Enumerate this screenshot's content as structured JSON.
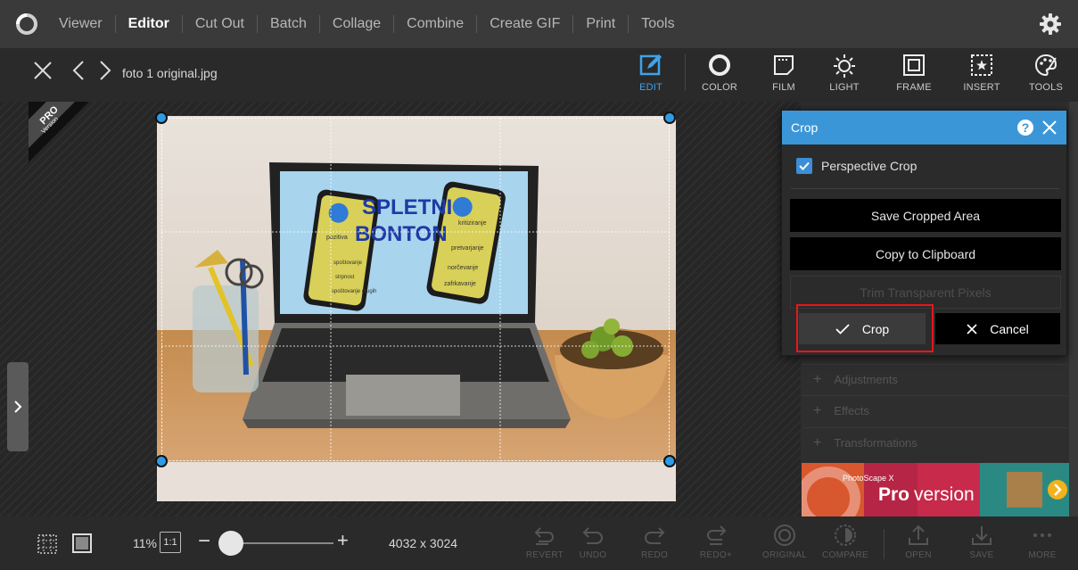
{
  "menu": {
    "items": [
      "Viewer",
      "Editor",
      "Cut Out",
      "Batch",
      "Collage",
      "Combine",
      "Create GIF",
      "Print",
      "Tools"
    ]
  },
  "file": {
    "name": "foto 1 original.jpg"
  },
  "tools": {
    "edit": "EDIT",
    "color": "COLOR",
    "film": "FILM",
    "light": "LIGHT",
    "frame": "FRAME",
    "insert": "INSERT",
    "tools": "TOOLS"
  },
  "pro_ribbon": {
    "line1": "PRO",
    "line2": "Version"
  },
  "photo_content": {
    "title_line1": "SPLETNI",
    "title_line2": "BONTON",
    "phone_left_words": [
      "pozitiva",
      "spoštovanje",
      "strpnost",
      "spoštovanje drugih"
    ],
    "phone_right_words": [
      "kritiziranje",
      "pretvarjanje",
      "norčevanje",
      "zafrkavanje"
    ]
  },
  "crop_dialog": {
    "title": "Crop",
    "perspective_label": "Perspective Crop",
    "perspective_checked": true,
    "save_cropped": "Save Cropped Area",
    "copy_clipboard": "Copy to Clipboard",
    "trim_transparent": "Trim Transparent Pixels",
    "crop": "Crop",
    "cancel": "Cancel"
  },
  "panel": {
    "adjustments": "Adjustments",
    "effects": "Effects",
    "transformations": "Transformations",
    "banner_line1": "PhotoScape X",
    "banner_line2_bold": "Pro",
    "banner_line2": "version"
  },
  "bottom": {
    "zoom": "11%",
    "ratio": "1:1",
    "image_size": "4032 x 3024",
    "zoom_level": 0.11,
    "buttons": [
      "REVERT",
      "UNDO",
      "REDO",
      "REDO+",
      "ORIGINAL",
      "COMPARE",
      "OPEN",
      "SAVE",
      "MORE"
    ]
  },
  "colors": {
    "accent": "#3b96d8",
    "highlight": "#e8161c",
    "background": "#2a2a2a",
    "menubar": "#3a3a3a"
  }
}
